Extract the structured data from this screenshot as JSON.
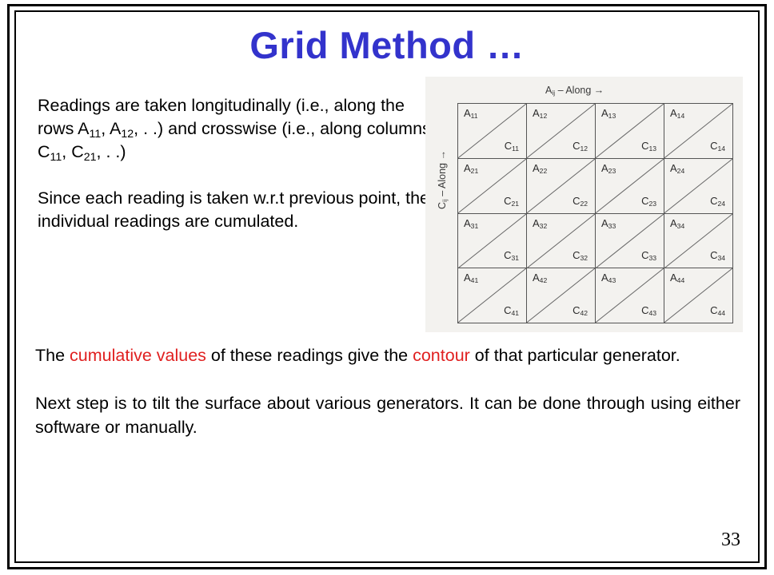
{
  "slide": {
    "title": "Grid Method …",
    "title_color": "#3333cc",
    "page_number": "33",
    "highlight_color": "#e02020"
  },
  "body_left": {
    "p1": {
      "seg1": "Readings are taken longitudinally (i.e., along the rows A",
      "sub1": "11",
      "seg2": ", A",
      "sub2": "12",
      "seg3": ", . .) and crosswise (i.e., along columns C",
      "sub3": "11",
      "seg4": ", C",
      "sub4": "21",
      "seg5": ", . .)"
    },
    "p2": "Since each reading is taken w.r.t previous point, the individual readings are cumulated."
  },
  "body_bottom": {
    "p1": {
      "seg1": "The ",
      "hl1": "cumulative values",
      "seg2": " of these readings give the ",
      "hl2": "contour",
      "seg3": " of that particular generator."
    },
    "p2": "Next step is to tilt the surface about various generators. It can be done through using either software or manually."
  },
  "diagram": {
    "axis_top": {
      "symbol": "A",
      "subscript": "ij",
      "text": " – Along →"
    },
    "axis_left": {
      "symbol": "C",
      "subscript": "ij",
      "text": " – Along →"
    },
    "rows": 4,
    "cols": 4,
    "cells": [
      {
        "a": "A",
        "a_sub": "11",
        "c": "C",
        "c_sub": "11"
      },
      {
        "a": "A",
        "a_sub": "12",
        "c": "C",
        "c_sub": "12"
      },
      {
        "a": "A",
        "a_sub": "13",
        "c": "C",
        "c_sub": "13"
      },
      {
        "a": "A",
        "a_sub": "14",
        "c": "C",
        "c_sub": "14"
      },
      {
        "a": "A",
        "a_sub": "21",
        "c": "C",
        "c_sub": "21"
      },
      {
        "a": "A",
        "a_sub": "22",
        "c": "C",
        "c_sub": "22"
      },
      {
        "a": "A",
        "a_sub": "23",
        "c": "C",
        "c_sub": "23"
      },
      {
        "a": "A",
        "a_sub": "24",
        "c": "C",
        "c_sub": "24"
      },
      {
        "a": "A",
        "a_sub": "31",
        "c": "C",
        "c_sub": "31"
      },
      {
        "a": "A",
        "a_sub": "32",
        "c": "C",
        "c_sub": "32"
      },
      {
        "a": "A",
        "a_sub": "33",
        "c": "C",
        "c_sub": "33"
      },
      {
        "a": "A",
        "a_sub": "34",
        "c": "C",
        "c_sub": "34"
      },
      {
        "a": "A",
        "a_sub": "41",
        "c": "C",
        "c_sub": "41"
      },
      {
        "a": "A",
        "a_sub": "42",
        "c": "C",
        "c_sub": "42"
      },
      {
        "a": "A",
        "a_sub": "43",
        "c": "C",
        "c_sub": "43"
      },
      {
        "a": "A",
        "a_sub": "44",
        "c": "C",
        "c_sub": "44"
      }
    ]
  }
}
